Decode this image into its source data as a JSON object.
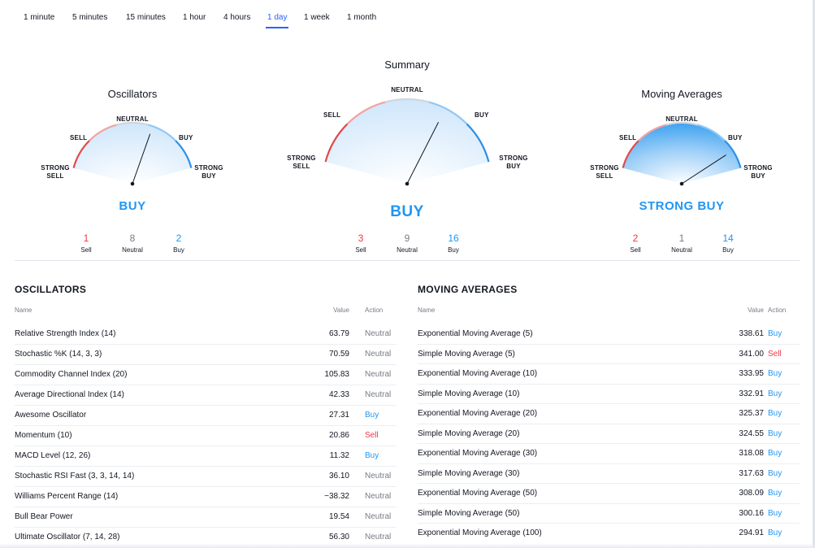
{
  "tabs": [
    {
      "label": "1 minute"
    },
    {
      "label": "5 minutes"
    },
    {
      "label": "15 minutes"
    },
    {
      "label": "1 hour"
    },
    {
      "label": "4 hours"
    },
    {
      "label": "1 day",
      "active": true
    },
    {
      "label": "1 week"
    },
    {
      "label": "1 month"
    }
  ],
  "gauge_labels": {
    "strong_sell": "STRONG SELL",
    "sell": "SELL",
    "neutral": "NEUTRAL",
    "buy": "BUY",
    "strong_buy": "STRONG BUY"
  },
  "count_labels": {
    "sell": "Sell",
    "neutral": "Neutral",
    "buy": "Buy"
  },
  "gauges": {
    "oscillators": {
      "title": "Oscillators",
      "verdict": "BUY",
      "sell": "1",
      "neutral": "8",
      "buy": "2",
      "needle_value": 0.63
    },
    "summary": {
      "title": "Summary",
      "verdict": "BUY",
      "sell": "3",
      "neutral": "9",
      "buy": "16",
      "needle_value": 0.68
    },
    "moving_averages": {
      "title": "Moving Averages",
      "verdict": "STRONG BUY",
      "sell": "2",
      "neutral": "1",
      "buy": "14",
      "needle_value": 0.88
    }
  },
  "colors": {
    "sell": "#f23645",
    "neutral": "#787b86",
    "buy": "#2196f3",
    "active_tab": "#2962ff"
  },
  "oscillators_table": {
    "title": "OSCILLATORS",
    "headers": {
      "name": "Name",
      "value": "Value",
      "action": "Action"
    },
    "rows": [
      {
        "name": "Relative Strength Index (14)",
        "value": "63.79",
        "action": "Neutral"
      },
      {
        "name": "Stochastic %K (14, 3, 3)",
        "value": "70.59",
        "action": "Neutral"
      },
      {
        "name": "Commodity Channel Index (20)",
        "value": "105.83",
        "action": "Neutral"
      },
      {
        "name": "Average Directional Index (14)",
        "value": "42.33",
        "action": "Neutral"
      },
      {
        "name": "Awesome Oscillator",
        "value": "27.31",
        "action": "Buy"
      },
      {
        "name": "Momentum (10)",
        "value": "20.86",
        "action": "Sell"
      },
      {
        "name": "MACD Level (12, 26)",
        "value": "11.32",
        "action": "Buy"
      },
      {
        "name": "Stochastic RSI Fast (3, 3, 14, 14)",
        "value": "36.10",
        "action": "Neutral"
      },
      {
        "name": "Williams Percent Range (14)",
        "value": "−38.32",
        "action": "Neutral"
      },
      {
        "name": "Bull Bear Power",
        "value": "19.54",
        "action": "Neutral"
      },
      {
        "name": "Ultimate Oscillator (7, 14, 28)",
        "value": "56.30",
        "action": "Neutral"
      }
    ]
  },
  "moving_averages_table": {
    "title": "MOVING AVERAGES",
    "headers": {
      "name": "Name",
      "value": "Value",
      "action": "Action"
    },
    "rows": [
      {
        "name": "Exponential Moving Average (5)",
        "value": "338.61",
        "action": "Buy"
      },
      {
        "name": "Simple Moving Average (5)",
        "value": "341.00",
        "action": "Sell"
      },
      {
        "name": "Exponential Moving Average (10)",
        "value": "333.95",
        "action": "Buy"
      },
      {
        "name": "Simple Moving Average (10)",
        "value": "332.91",
        "action": "Buy"
      },
      {
        "name": "Exponential Moving Average (20)",
        "value": "325.37",
        "action": "Buy"
      },
      {
        "name": "Simple Moving Average (20)",
        "value": "324.55",
        "action": "Buy"
      },
      {
        "name": "Exponential Moving Average (30)",
        "value": "318.08",
        "action": "Buy"
      },
      {
        "name": "Simple Moving Average (30)",
        "value": "317.63",
        "action": "Buy"
      },
      {
        "name": "Exponential Moving Average (50)",
        "value": "308.09",
        "action": "Buy"
      },
      {
        "name": "Simple Moving Average (50)",
        "value": "300.16",
        "action": "Buy"
      },
      {
        "name": "Exponential Moving Average (100)",
        "value": "294.91",
        "action": "Buy"
      }
    ]
  }
}
